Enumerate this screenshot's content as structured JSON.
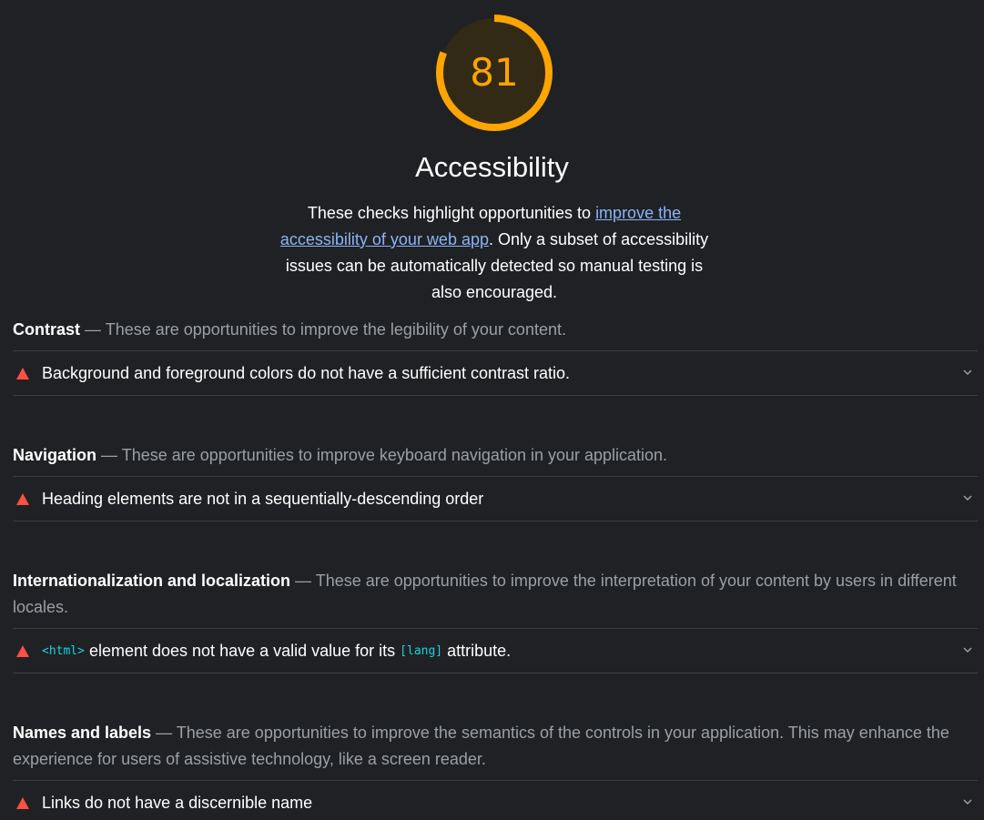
{
  "gauge": {
    "score": "81",
    "score_fraction": 0.81,
    "color": "#ffa400"
  },
  "category": {
    "title": "Accessibility",
    "desc_before": "These checks highlight opportunities to ",
    "desc_link": "improve the accessibility of your web app",
    "desc_after": ". Only a subset of accessibility issues can be automatically detected so manual testing is also encouraged."
  },
  "groups": [
    {
      "title": "Contrast",
      "description": "These are opportunities to improve the legibility of your content.",
      "audit": "Background and foreground colors do not have a sufficient contrast ratio."
    },
    {
      "title": "Navigation",
      "description": "These are opportunities to improve keyboard navigation in your application.",
      "audit": "Heading elements are not in a sequentially-descending order"
    },
    {
      "title": "Internationalization and localization",
      "description": "These are opportunities to improve the interpretation of your content by users in different locales.",
      "audit_code1": "<html>",
      "audit_mid": "element does not have a valid value for its",
      "audit_code2": "[lang]",
      "audit_end": "attribute."
    },
    {
      "title": "Names and labels",
      "description": "These are opportunities to improve the semantics of the controls in your application. This may enhance the experience for users of assistive technology, like a screen reader.",
      "audit": "Links do not have a discernible name"
    }
  ],
  "separator": " — ",
  "icons": {
    "fail": "fail-triangle-icon",
    "expand": "chevron-down-icon"
  },
  "colors": {
    "fail": "#ff4e42",
    "link": "#8ab4f8",
    "code": "#19d3e0",
    "background": "#202124"
  }
}
